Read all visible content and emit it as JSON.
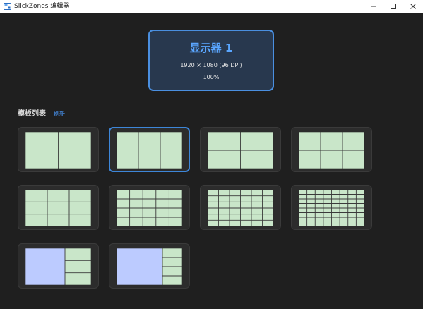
{
  "window": {
    "title": "SlickZones 编辑器",
    "buttons": [
      "minimize",
      "maximize",
      "close"
    ]
  },
  "monitor": {
    "name": "显示器 1",
    "resolution": "1920 × 1080 (96 DPI)",
    "scale": "100%",
    "selected": true
  },
  "templates_section": {
    "title": "模板列表",
    "refresh_label": "刷新"
  },
  "colors": {
    "zone_fill": "#c9e6c9",
    "zone_line": "#3a3a3a",
    "main_zone_fill": "#bccbff",
    "accent": "#4a8fe0"
  },
  "templates": [
    {
      "name": "columns-2",
      "cols": 2,
      "rows": 1,
      "selected": false
    },
    {
      "name": "columns-3",
      "cols": 3,
      "rows": 1,
      "selected": true
    },
    {
      "name": "grid-2x2",
      "cols": 2,
      "rows": 2,
      "selected": false
    },
    {
      "name": "grid-3x2",
      "cols": 3,
      "rows": 2,
      "selected": false
    },
    {
      "name": "grid-3x3",
      "cols": 3,
      "rows": 3,
      "selected": false
    },
    {
      "name": "grid-5x4",
      "cols": 5,
      "rows": 4,
      "selected": false
    },
    {
      "name": "grid-6x6",
      "cols": 6,
      "rows": 6,
      "selected": false
    },
    {
      "name": "grid-8x8",
      "cols": 8,
      "rows": 8,
      "selected": false
    },
    {
      "name": "main-left-2x3",
      "type": "main",
      "main_fraction": 0.6,
      "side_cols": 2,
      "side_rows": 3,
      "selected": false
    },
    {
      "name": "main-left-1x4",
      "type": "main",
      "main_fraction": 0.7,
      "side_cols": 1,
      "side_rows": 4,
      "selected": false
    }
  ]
}
